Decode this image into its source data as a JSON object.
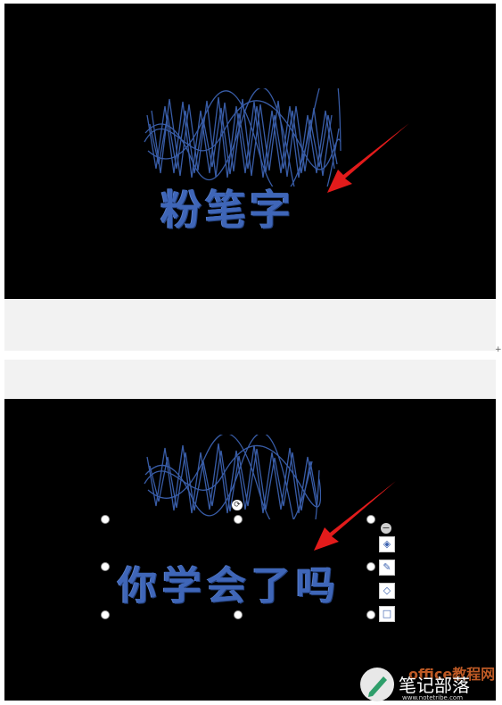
{
  "slide1": {
    "chalk_text": "粉笔字"
  },
  "slide2": {
    "chalk_text": "你学会了吗"
  },
  "watermark": {
    "name": "笔记部落",
    "site": "www.notetribe.com",
    "office_site": "office教程网"
  },
  "colors": {
    "chalk_blue": "#3f66b8",
    "arrow_red": "#e21b1b",
    "slide_bg": "#000000"
  },
  "icons": [
    "rotate-icon",
    "collapse-icon",
    "layers-icon",
    "pen-icon",
    "fill-icon",
    "border-icon",
    "pen-watermark-icon"
  ]
}
